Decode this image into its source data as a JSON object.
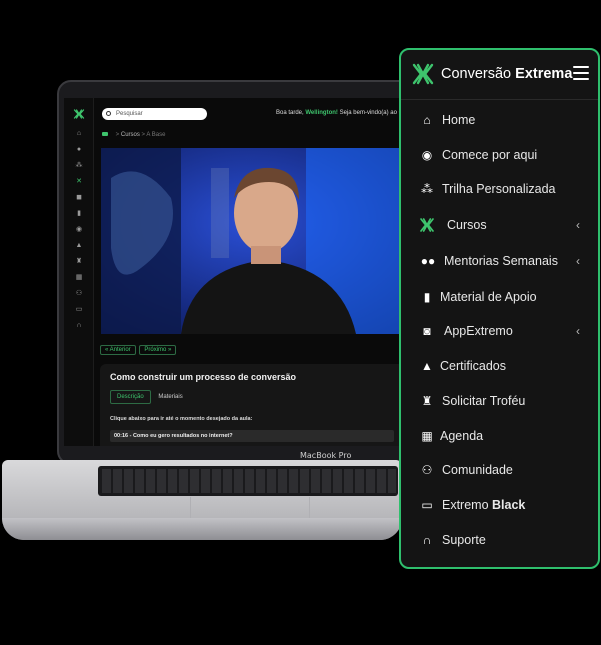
{
  "laptop": {
    "model_label": "MacBook Pro",
    "search": {
      "placeholder": "Pesquisar"
    },
    "greeting": {
      "prefix": "Boa tarde,",
      "name": "Wellington!",
      "suffix": "Seja bem-vindo(a) ao C"
    },
    "breadcrumb": {
      "section": "Cursos",
      "sep": ">",
      "current": "A Base"
    },
    "nav": {
      "prev": "« Anterior",
      "next": "Próximo »"
    },
    "lesson": {
      "title": "Como construir um processo de conversão",
      "tabs": [
        {
          "label": "Descrição"
        },
        {
          "label": "Materiais"
        }
      ],
      "hint": "Clique abaixo para ir até o momento desejado da aula:",
      "timestamp": "00:16 - Como eu gero resultados no internet?"
    }
  },
  "menu": {
    "brand": {
      "regular": "Conversão",
      "bold": "Extrema"
    },
    "accent_color": "#2fbf6d",
    "items": [
      {
        "label": "Home",
        "icon": "home-icon",
        "chevron": false
      },
      {
        "label": "Comece por aqui",
        "icon": "compass-icon",
        "chevron": false
      },
      {
        "label": "Trilha Personalizada",
        "icon": "sitemap-icon",
        "chevron": false
      },
      {
        "label": "Cursos",
        "icon": "brand-x-icon",
        "chevron": true
      },
      {
        "label": "Mentorias Semanais",
        "icon": "chat-bubbles-icon",
        "chevron": true
      },
      {
        "label": "Material de Apoio",
        "icon": "book-icon",
        "chevron": false
      },
      {
        "label": "AppExtremo",
        "icon": "robot-icon",
        "chevron": true
      },
      {
        "label": "Certificados",
        "icon": "graduation-cap-icon",
        "chevron": false
      },
      {
        "label": "Solicitar Troféu",
        "icon": "trophy-icon",
        "chevron": false
      },
      {
        "label": "Agenda",
        "icon": "calendar-icon",
        "chevron": false
      },
      {
        "label": "Comunidade",
        "icon": "users-icon",
        "chevron": false
      },
      {
        "label": "Extremo",
        "label_bold": "Black",
        "icon": "monitor-icon",
        "chevron": false
      },
      {
        "label": "Suporte",
        "icon": "headset-icon",
        "chevron": false
      }
    ]
  }
}
